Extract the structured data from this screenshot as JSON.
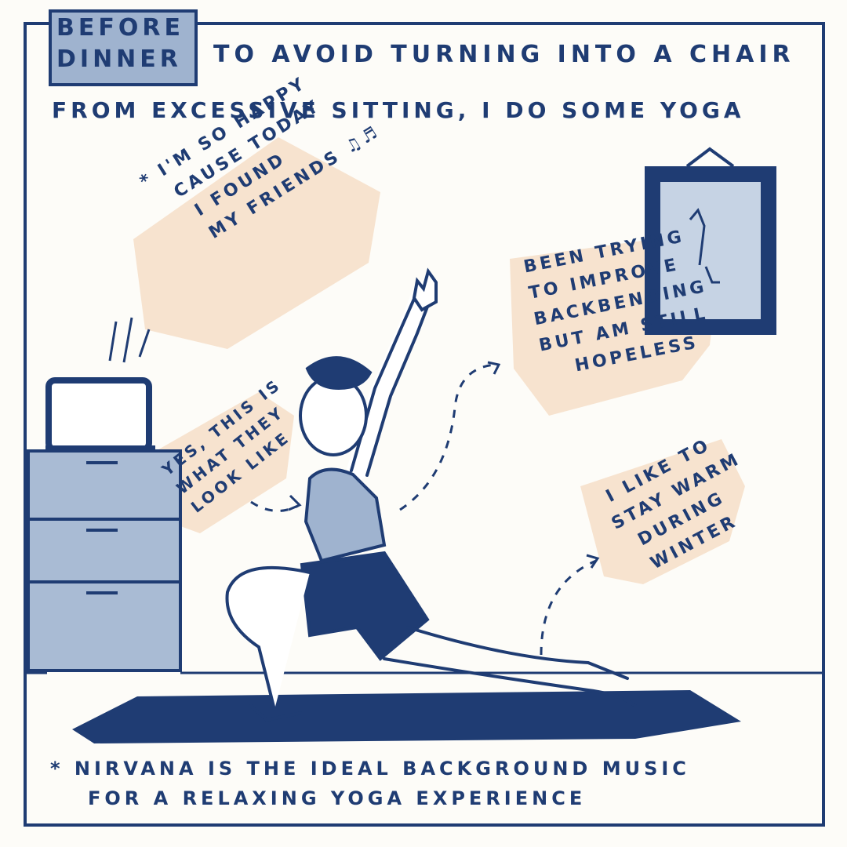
{
  "heading": {
    "tag_line1": "BEFORE",
    "tag_line2": "DINNER",
    "line1": "TO AVOID TURNING INTO A CHAIR",
    "line2": "FROM EXCESSIVE SITTING, I DO SOME YOGA"
  },
  "bubbles": {
    "song": [
      "* I'M SO HAPPY",
      "CAUSE TODAY",
      "I FOUND",
      "MY FRIENDS ♫♬"
    ],
    "backbend": [
      "BEEN TRYING",
      "TO IMPROVE",
      "BACKBENDING",
      "BUT AM STILL",
      "HOPELESS"
    ],
    "look": [
      "YES, THIS IS",
      "WHAT THEY",
      "LOOK LIKE"
    ],
    "warm": [
      "I LIKE TO",
      "STAY WARM",
      "DURING",
      "WINTER"
    ]
  },
  "footnote": {
    "line1": "* NIRVANA IS THE IDEAL BACKGROUND MUSIC",
    "line2": "FOR A RELAXING YOGA EXPERIENCE"
  },
  "colors": {
    "ink": "#1f3c73",
    "wash": "#9fb3cf",
    "peach": "#f7e3cf",
    "paper": "#fdfcf8"
  },
  "icons": [
    "laptop-icon",
    "music-note-icon",
    "mirror-icon"
  ]
}
